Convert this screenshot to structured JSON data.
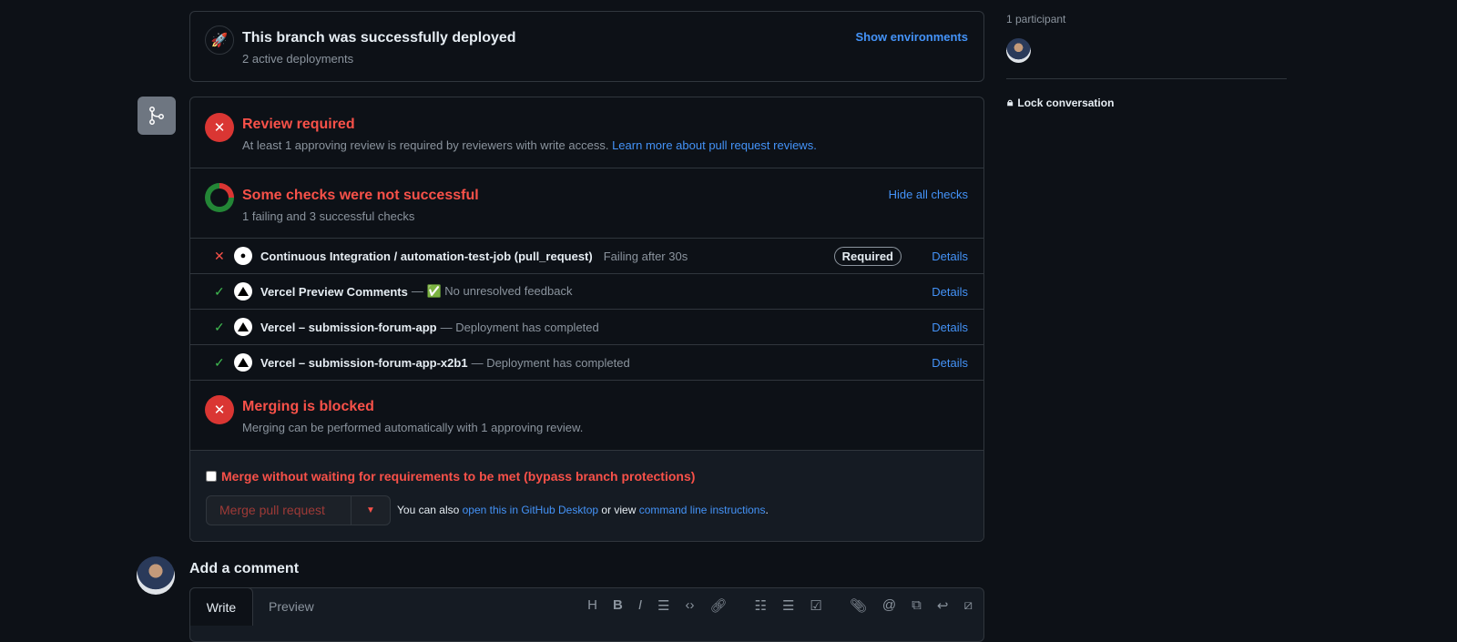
{
  "deploy": {
    "title": "This branch was successfully deployed",
    "subtitle": "2 active deployments",
    "action": "Show environments"
  },
  "review": {
    "title": "Review required",
    "text": "At least 1 approving review is required by reviewers with write access.",
    "link": "Learn more about pull request reviews."
  },
  "checks": {
    "title": "Some checks were not successful",
    "subtitle": "1 failing and 3 successful checks",
    "action": "Hide all checks",
    "items": [
      {
        "status": "fail",
        "name": "Continuous Integration / automation-test-job (pull_request)",
        "desc": "Failing after 30s",
        "badge": "Required",
        "details": "Details"
      },
      {
        "status": "success",
        "name": "Vercel Preview Comments",
        "desc": "— ✅ No unresolved feedback",
        "details": "Details"
      },
      {
        "status": "success",
        "name": "Vercel – submission-forum-app",
        "desc": "— Deployment has completed",
        "details": "Details"
      },
      {
        "status": "success",
        "name": "Vercel – submission-forum-app-x2b1",
        "desc": "— Deployment has completed",
        "details": "Details"
      }
    ]
  },
  "merging": {
    "title": "Merging is blocked",
    "text": "Merging can be performed automatically with 1 approving review."
  },
  "bypass": {
    "label": "Merge without waiting for requirements to be met (bypass branch protections)",
    "checked": false
  },
  "merge": {
    "button": "Merge pull request",
    "also": "You can also",
    "desktop": "open this in GitHub Desktop",
    "orview": "or view",
    "cli": "command line instructions",
    "period": "."
  },
  "comment": {
    "title": "Add a comment",
    "tab_write": "Write",
    "tab_preview": "Preview"
  },
  "sidebar": {
    "participants": "1 participant",
    "lock": "Lock conversation"
  },
  "colors": {
    "bg": "#0d1117",
    "danger": "#f85149",
    "success": "#3fb950",
    "link": "#4493f8"
  }
}
